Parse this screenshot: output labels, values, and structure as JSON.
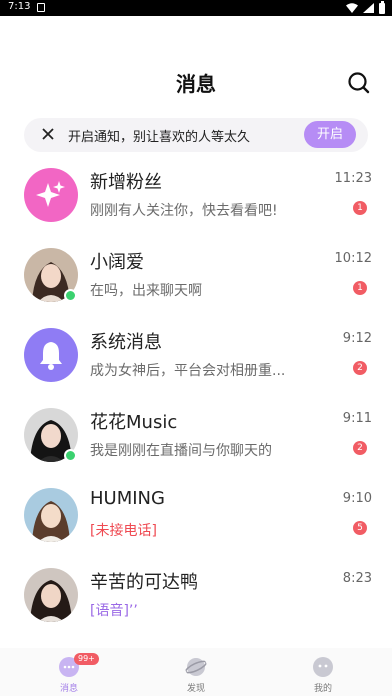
{
  "statusbar": {
    "time": "7:13"
  },
  "header": {
    "title": "消息"
  },
  "notification": {
    "text": "开启通知，别让喜欢的人等太久",
    "button": "开启"
  },
  "conversations": [
    {
      "name": "新增粉丝",
      "time": "11:23",
      "preview": "刚刚有人关注你，快去看看吧!",
      "unread": "1",
      "avatar": "sparkle-icon",
      "online": false
    },
    {
      "name": "小阔爱",
      "time": "10:12",
      "preview": "在吗，出来聊天啊",
      "unread": "1",
      "avatar": "user-photo",
      "online": true
    },
    {
      "name": "系统消息",
      "time": "9:12",
      "preview": "成为女神后，平台会对相册重...",
      "unread": "2",
      "avatar": "bell-icon",
      "online": false
    },
    {
      "name": "花花Music",
      "time": "9:11",
      "preview": "我是刚刚在直播间与你聊天的",
      "unread": "2",
      "avatar": "user-photo",
      "online": true
    },
    {
      "name": "HUMING",
      "time": "9:10",
      "preview": "[未接电话]",
      "unread": "5",
      "avatar": "user-photo",
      "online": false
    },
    {
      "name": "辛苦的可达鸭",
      "time": "8:23",
      "preview": "[语音]’’",
      "unread": "",
      "avatar": "user-photo",
      "online": false
    }
  ],
  "tabbar": {
    "tabs": [
      {
        "label": "消息",
        "badge": "99+"
      },
      {
        "label": "发现"
      },
      {
        "label": "我的"
      }
    ]
  },
  "colors": {
    "accent": "#b68cf5",
    "badge": "#f15c64",
    "online": "#3bd16f",
    "fans_avatar": "#f266c4",
    "system_avatar": "#8f7cf4"
  }
}
